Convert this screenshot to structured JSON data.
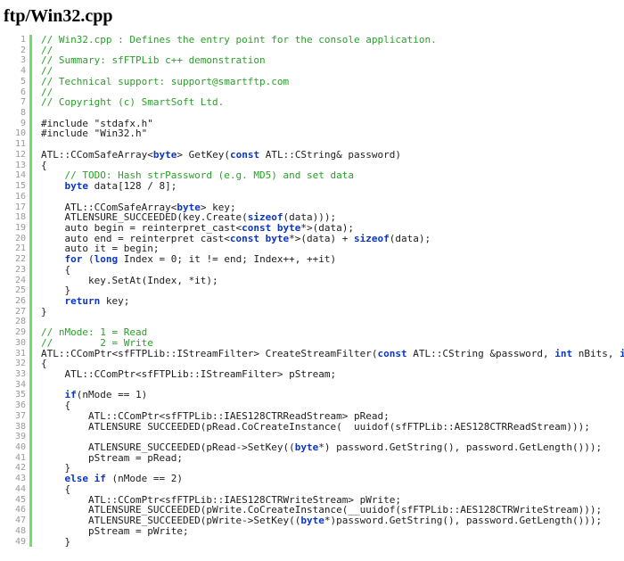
{
  "page": {
    "title": "ftp/Win32.cpp"
  },
  "colors": {
    "comment": "#2aa02a",
    "keyword": "#0a36c8",
    "plain": "#1c1c1c",
    "line_number": "#999999",
    "gutter_bar": "#6ce06c",
    "background": "#ffffff"
  },
  "editor": {
    "language": "cpp",
    "first_line": 1,
    "last_visible_line": 49,
    "lines": [
      {
        "n": 1,
        "tokens": [
          {
            "t": "c",
            "v": "// Win32.cpp : Defines the entry point for the console application."
          }
        ]
      },
      {
        "n": 2,
        "tokens": [
          {
            "t": "c",
            "v": "//"
          }
        ]
      },
      {
        "n": 3,
        "tokens": [
          {
            "t": "c",
            "v": "// Summary: sfFTPLib c++ demonstration"
          }
        ]
      },
      {
        "n": 4,
        "tokens": [
          {
            "t": "c",
            "v": "//"
          }
        ]
      },
      {
        "n": 5,
        "tokens": [
          {
            "t": "c",
            "v": "// Technical support: support@smartftp.com"
          }
        ]
      },
      {
        "n": 6,
        "tokens": [
          {
            "t": "c",
            "v": "//"
          }
        ]
      },
      {
        "n": 7,
        "tokens": [
          {
            "t": "c",
            "v": "// Copyright (c) SmartSoft Ltd."
          }
        ]
      },
      {
        "n": 8,
        "tokens": []
      },
      {
        "n": 9,
        "tokens": [
          {
            "t": "p",
            "v": "#include \"stdafx.h\""
          }
        ]
      },
      {
        "n": 10,
        "tokens": [
          {
            "t": "p",
            "v": "#include \"Win32.h\""
          }
        ]
      },
      {
        "n": 11,
        "tokens": []
      },
      {
        "n": 12,
        "tokens": [
          {
            "t": "p",
            "v": "ATL::CComSafeArray<"
          },
          {
            "t": "k",
            "v": "byte"
          },
          {
            "t": "p",
            "v": "> GetKey("
          },
          {
            "t": "k",
            "v": "const"
          },
          {
            "t": "p",
            "v": " ATL::CString& password)"
          }
        ]
      },
      {
        "n": 13,
        "tokens": [
          {
            "t": "p",
            "v": "{"
          }
        ]
      },
      {
        "n": 14,
        "tokens": [
          {
            "t": "c",
            "v": "    // TODO: Hash strPassword (e.g. MD5) and set data"
          }
        ]
      },
      {
        "n": 15,
        "tokens": [
          {
            "t": "p",
            "v": "    "
          },
          {
            "t": "k",
            "v": "byte"
          },
          {
            "t": "p",
            "v": " data[128 / 8];"
          }
        ]
      },
      {
        "n": 16,
        "tokens": []
      },
      {
        "n": 17,
        "tokens": [
          {
            "t": "p",
            "v": "    ATL::CComSafeArray<"
          },
          {
            "t": "k",
            "v": "byte"
          },
          {
            "t": "p",
            "v": "> key;"
          }
        ]
      },
      {
        "n": 18,
        "tokens": [
          {
            "t": "p",
            "v": "    ATLENSURE_SUCCEEDED(key.Create("
          },
          {
            "t": "k",
            "v": "sizeof"
          },
          {
            "t": "p",
            "v": "(data)));"
          }
        ]
      },
      {
        "n": 19,
        "tokens": [
          {
            "t": "p",
            "v": "    auto begin = reinterpret_cast<"
          },
          {
            "t": "k",
            "v": "const"
          },
          {
            "t": "p",
            "v": " "
          },
          {
            "t": "k",
            "v": "byte"
          },
          {
            "t": "p",
            "v": "*>(data);"
          }
        ]
      },
      {
        "n": 20,
        "tokens": [
          {
            "t": "p",
            "v": "    auto end = reinterpret_cast<"
          },
          {
            "t": "k",
            "v": "const"
          },
          {
            "t": "p",
            "v": " "
          },
          {
            "t": "k",
            "v": "byte"
          },
          {
            "t": "p",
            "v": "*>(data) + "
          },
          {
            "t": "k",
            "v": "sizeof"
          },
          {
            "t": "p",
            "v": "(data);"
          }
        ]
      },
      {
        "n": 21,
        "tokens": [
          {
            "t": "p",
            "v": "    auto it = begin;"
          }
        ]
      },
      {
        "n": 22,
        "tokens": [
          {
            "t": "p",
            "v": "    "
          },
          {
            "t": "k",
            "v": "for"
          },
          {
            "t": "p",
            "v": " ("
          },
          {
            "t": "k",
            "v": "long"
          },
          {
            "t": "p",
            "v": " Index = 0; it != end; Index++, ++it)"
          }
        ]
      },
      {
        "n": 23,
        "tokens": [
          {
            "t": "p",
            "v": "    {"
          }
        ]
      },
      {
        "n": 24,
        "tokens": [
          {
            "t": "p",
            "v": "        key.SetAt(Index, *it);"
          }
        ]
      },
      {
        "n": 25,
        "tokens": [
          {
            "t": "p",
            "v": "    }"
          }
        ]
      },
      {
        "n": 26,
        "tokens": [
          {
            "t": "p",
            "v": "    "
          },
          {
            "t": "k",
            "v": "return"
          },
          {
            "t": "p",
            "v": " key;"
          }
        ]
      },
      {
        "n": 27,
        "tokens": [
          {
            "t": "p",
            "v": "}"
          }
        ]
      },
      {
        "n": 28,
        "tokens": []
      },
      {
        "n": 29,
        "tokens": [
          {
            "t": "c",
            "v": "// nMode: 1 = Read"
          }
        ]
      },
      {
        "n": 30,
        "tokens": [
          {
            "t": "c",
            "v": "//        2 = Write"
          }
        ]
      },
      {
        "n": 31,
        "tokens": [
          {
            "t": "p",
            "v": "ATL::CComPtr<sfFTPLib::IStreamFilter> CreateStreamFilter("
          },
          {
            "t": "k",
            "v": "const"
          },
          {
            "t": "p",
            "v": " ATL::CString &password, "
          },
          {
            "t": "k",
            "v": "int"
          },
          {
            "t": "p",
            "v": " nBits, "
          },
          {
            "t": "k",
            "v": "int"
          },
          {
            "t": "p",
            "v": " nMode)"
          }
        ]
      },
      {
        "n": 32,
        "tokens": [
          {
            "t": "p",
            "v": "{"
          }
        ]
      },
      {
        "n": 33,
        "tokens": [
          {
            "t": "p",
            "v": "    ATL::CComPtr<sfFTPLib::IStreamFilter> pStream;"
          }
        ]
      },
      {
        "n": 34,
        "tokens": []
      },
      {
        "n": 35,
        "tokens": [
          {
            "t": "p",
            "v": "    "
          },
          {
            "t": "k",
            "v": "if"
          },
          {
            "t": "p",
            "v": "(nMode == 1)"
          }
        ]
      },
      {
        "n": 36,
        "tokens": [
          {
            "t": "p",
            "v": "    {"
          }
        ]
      },
      {
        "n": 37,
        "tokens": [
          {
            "t": "p",
            "v": "        ATL::CComPtr<sfFTPLib::IAES128CTRReadStream> pRead;"
          }
        ]
      },
      {
        "n": 38,
        "tokens": [
          {
            "t": "p",
            "v": "        ATLENSURE_SUCCEEDED(pRead.CoCreateInstance(__uuidof(sfFTPLib::AES128CTRReadStream)));"
          }
        ]
      },
      {
        "n": 39,
        "tokens": []
      },
      {
        "n": 40,
        "tokens": [
          {
            "t": "p",
            "v": "        ATLENSURE_SUCCEEDED(pRead->SetKey(("
          },
          {
            "t": "k",
            "v": "byte"
          },
          {
            "t": "p",
            "v": "*) password.GetString(), password.GetLength()));"
          }
        ]
      },
      {
        "n": 41,
        "tokens": [
          {
            "t": "p",
            "v": "        pStream = pRead;"
          }
        ]
      },
      {
        "n": 42,
        "tokens": [
          {
            "t": "p",
            "v": "    }"
          }
        ]
      },
      {
        "n": 43,
        "tokens": [
          {
            "t": "p",
            "v": "    "
          },
          {
            "t": "k",
            "v": "else if"
          },
          {
            "t": "p",
            "v": " (nMode == 2)"
          }
        ]
      },
      {
        "n": 44,
        "tokens": [
          {
            "t": "p",
            "v": "    {"
          }
        ]
      },
      {
        "n": 45,
        "tokens": [
          {
            "t": "p",
            "v": "        ATL::CComPtr<sfFTPLib::IAES128CTRWriteStream> pWrite;"
          }
        ]
      },
      {
        "n": 46,
        "tokens": [
          {
            "t": "p",
            "v": "        ATLENSURE_SUCCEEDED(pWrite.CoCreateInstance(__uuidof(sfFTPLib::AES128CTRWriteStream)));"
          }
        ]
      },
      {
        "n": 47,
        "tokens": [
          {
            "t": "p",
            "v": "        ATLENSURE_SUCCEEDED(pWrite->SetKey(("
          },
          {
            "t": "k",
            "v": "byte"
          },
          {
            "t": "p",
            "v": "*)password.GetString(), password.GetLength()));"
          }
        ]
      },
      {
        "n": 48,
        "tokens": [
          {
            "t": "p",
            "v": "        pStream = pWrite;"
          }
        ]
      },
      {
        "n": 49,
        "tokens": [
          {
            "t": "p",
            "v": "    }"
          }
        ]
      }
    ]
  }
}
